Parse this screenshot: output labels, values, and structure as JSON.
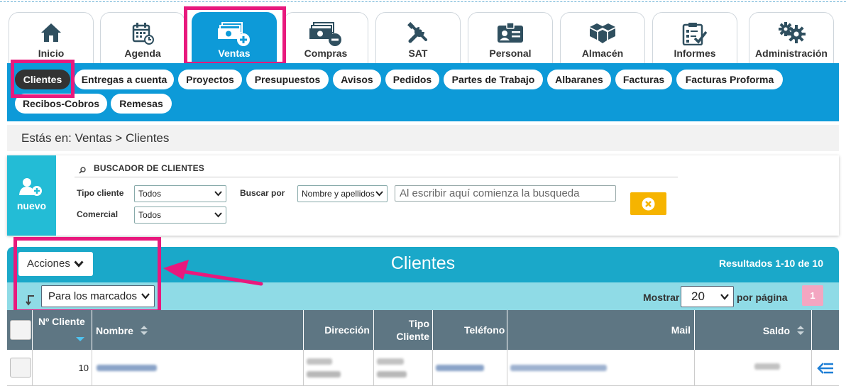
{
  "main_tabs": [
    {
      "label": "Inicio",
      "icon": "home-icon"
    },
    {
      "label": "Agenda",
      "icon": "calendar-icon"
    },
    {
      "label": "Ventas",
      "icon": "cash-plus-icon",
      "active": true
    },
    {
      "label": "Compras",
      "icon": "cash-minus-icon"
    },
    {
      "label": "SAT",
      "icon": "tools-icon"
    },
    {
      "label": "Personal",
      "icon": "id-card-icon"
    },
    {
      "label": "Almacén",
      "icon": "boxes-icon"
    },
    {
      "label": "Informes",
      "icon": "clipboard-check-icon"
    },
    {
      "label": "Administración",
      "icon": "gears-icon"
    }
  ],
  "sub_nav": [
    {
      "label": "Clientes",
      "active": true
    },
    {
      "label": "Entregas a cuenta"
    },
    {
      "label": "Proyectos"
    },
    {
      "label": "Presupuestos"
    },
    {
      "label": "Avisos"
    },
    {
      "label": "Pedidos"
    },
    {
      "label": "Partes de Trabajo"
    },
    {
      "label": "Albaranes"
    },
    {
      "label": "Facturas"
    },
    {
      "label": "Facturas Proforma"
    },
    {
      "label": "Recibos-Cobros"
    },
    {
      "label": "Remesas"
    }
  ],
  "breadcrumb": "Estás en: Ventas > Clientes",
  "search": {
    "new_label": "nuevo",
    "title": "BUSCADOR DE CLIENTES",
    "tipo_cliente_label": "Tipo cliente",
    "tipo_cliente_value": "Todos",
    "comercial_label": "Comercial",
    "comercial_value": "Todos",
    "buscar_por_label": "Buscar por",
    "buscar_por_value": "Nombre y apellidos",
    "query_placeholder": "Al escribir aquí comienza la busqueda"
  },
  "results": {
    "actions_label": "Acciones",
    "title": "Clientes",
    "count_text": "Resultados 1-10 de 10",
    "bulk_select_value": "Para los marcados",
    "show_label": "Mostrar",
    "per_page_value": "20",
    "per_page_suffix": "por página",
    "current_page": "1"
  },
  "table": {
    "columns": [
      "Nº Cliente",
      "Nombre",
      "Dirección",
      "Tipo Cliente",
      "Teléfono",
      "Mail",
      "Saldo"
    ],
    "rows": [
      {
        "numero": "10"
      }
    ]
  },
  "colors": {
    "primary_blue": "#0d9ad8",
    "teal": "#1aa8c9",
    "light_teal": "#8fdbe6",
    "table_header": "#5e7683",
    "highlight_pink": "#e8197d",
    "clear_button": "#f6b400"
  }
}
